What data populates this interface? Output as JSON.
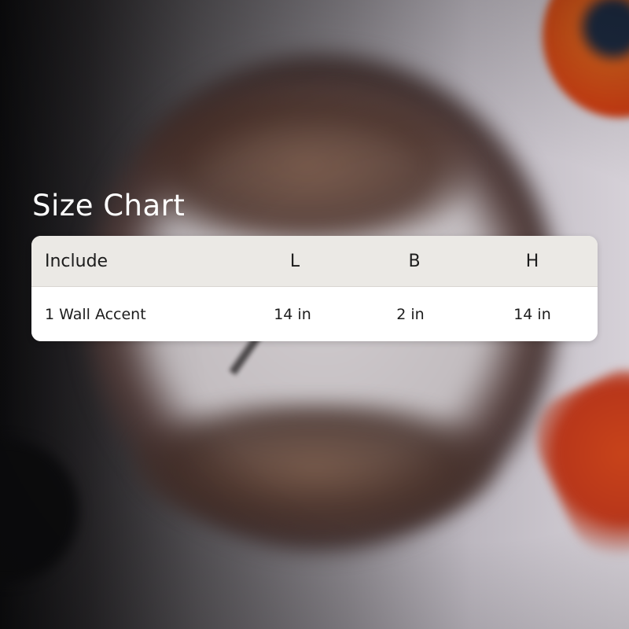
{
  "title": "Size Chart",
  "table": {
    "headers": {
      "include": "Include",
      "l": "L",
      "b": "B",
      "h": "H"
    },
    "rows": [
      {
        "include": "1 Wall Accent",
        "l": "14 in",
        "b": "2 in",
        "h": "14 in"
      }
    ]
  },
  "colors": {
    "header_background": "#ebe9e5",
    "row_background": "#ffffff",
    "title_text": "#ffffff",
    "table_text": "#1c1c1c"
  }
}
